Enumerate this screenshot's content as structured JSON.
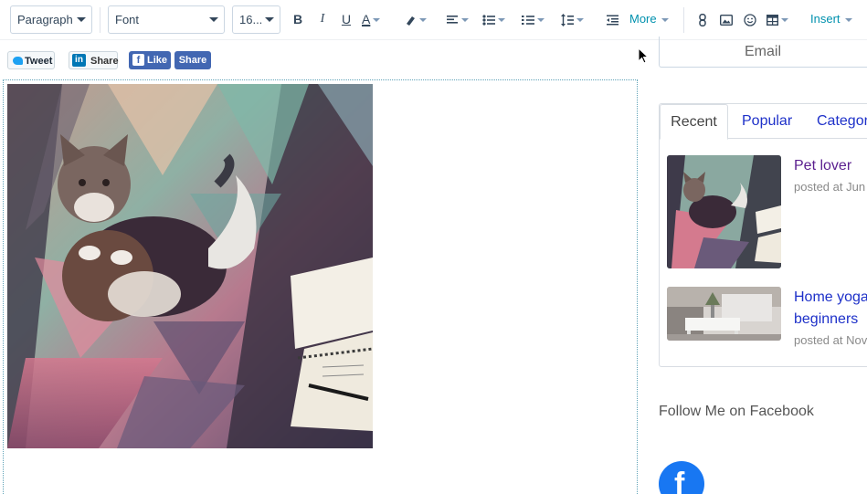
{
  "toolbar": {
    "paragraph_select": "Paragraph",
    "font_select": "Font",
    "size_select": "16...",
    "bold": "B",
    "italic": "I",
    "underline": "U",
    "text_color": "A",
    "more_label": "More",
    "insert_label": "Insert",
    "accent_color": "#0091ae"
  },
  "share": {
    "tweet": "Tweet",
    "linkedin": "Share",
    "linkedin_logo": "in",
    "fb_like": "Like",
    "fb_logo": "f",
    "fb_share": "Share"
  },
  "sidebar": {
    "email_label": "Email",
    "tabs": [
      {
        "label": "Recent"
      },
      {
        "label": "Popular"
      },
      {
        "label": "Categor"
      }
    ],
    "posts": [
      {
        "title": "Pet lover",
        "meta": "posted at Jun"
      },
      {
        "title_line1": "Home yoga",
        "title_line2": "beginners",
        "meta": "posted at Nov"
      }
    ],
    "follow_heading": "Follow Me on Facebook",
    "fb_letter": "f"
  }
}
